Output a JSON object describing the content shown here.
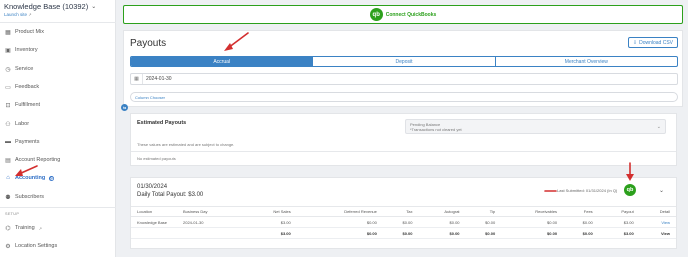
{
  "sidebar": {
    "title": "Knowledge Base (10392)",
    "launch_label": "Launch site",
    "items": [
      {
        "label": "Product Mix",
        "icon": "grid-icon"
      },
      {
        "label": "Inventory",
        "icon": "box-icon"
      },
      {
        "label": "Service",
        "icon": "clock-icon"
      },
      {
        "label": "Feedback",
        "icon": "chat-icon"
      },
      {
        "label": "Fulfillment",
        "icon": "truck-icon"
      },
      {
        "label": "Labor",
        "icon": "person-icon"
      },
      {
        "label": "Payments",
        "icon": "card-icon"
      },
      {
        "label": "Account Reporting",
        "icon": "report-icon"
      },
      {
        "label": "Accounting",
        "icon": "bank-icon"
      },
      {
        "label": "Subscribers",
        "icon": "users-icon"
      }
    ],
    "section_label": "SETUP",
    "setup_items": [
      {
        "label": "Training",
        "icon": "graduation-icon"
      },
      {
        "label": "Location Settings",
        "icon": "settings-icon"
      }
    ]
  },
  "quickbooks": {
    "logo": "qb",
    "label": "Connect QuickBooks"
  },
  "payouts": {
    "title": "Payouts",
    "download_label": "Download CSV",
    "tabs": [
      "Accrual",
      "Deposit",
      "Merchant Overview"
    ],
    "date_value": "2024-01-30",
    "column_chooser": "Column Chooser"
  },
  "estimated": {
    "title": "Estimated Payouts",
    "pending_title": "Pending Balance",
    "pending_sub": "*Transactions not cleared yet",
    "note": "These values are estimated and are subject to change.",
    "empty": "No estimated payouts"
  },
  "day": {
    "date": "01/30/2024",
    "total": "Daily Total Payout: $3.00",
    "last_submitted": "Last Submitted: 01/31/2024 (In Q)",
    "columns": [
      "Location",
      "Business Day",
      "Net Sales",
      "Deferred Revenue",
      "Tax",
      "Autograt",
      "Tip",
      "Receivables",
      "Fees",
      "Payout",
      "Detail"
    ],
    "row": [
      "Knowledge Base",
      "2024-01-30",
      "$3.00",
      "$0.00",
      "$0.00",
      "$0.00",
      "$0.00",
      "$0.00",
      "$0.00",
      "$3.00",
      "View"
    ],
    "total_row": [
      "",
      "",
      "$3.00",
      "$0.00",
      "$0.00",
      "$0.00",
      "$0.00",
      "$0.00",
      "$0.00",
      "$3.00",
      "View"
    ]
  },
  "colors": {
    "accent": "#3b82c4",
    "quickbooks": "#2ca01c",
    "annotation": "#d32f2f"
  }
}
